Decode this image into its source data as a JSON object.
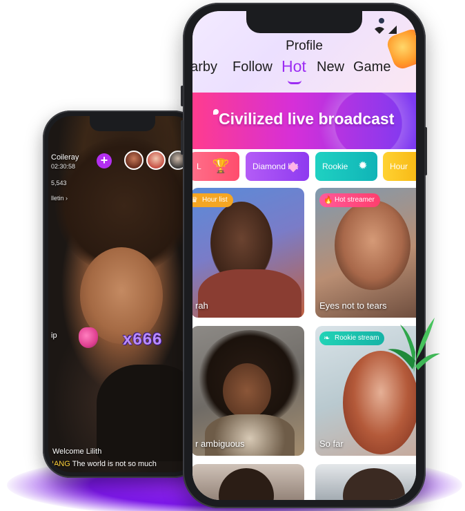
{
  "live_room": {
    "host_name": "Coileray",
    "host_id": "02:30:58",
    "follower_count": "5,543",
    "bulletin_label": "lletin",
    "add_button": "+",
    "side_label": "ip",
    "gift_combo": "x666",
    "welcome_message": "Welcome Lilith",
    "chat_user": "NANG",
    "chat_message": "The world is not so much"
  },
  "app": {
    "page_title": "Profile",
    "tabs": [
      {
        "label": "Nearby",
        "display": "earby"
      },
      {
        "label": "Follow",
        "display": "Follow"
      },
      {
        "label": "Hot",
        "display": "Hot",
        "active": true
      },
      {
        "label": "New",
        "display": "New"
      },
      {
        "label": "Game",
        "display": "Game"
      }
    ],
    "banner_text": "Civilized live broadcast",
    "chips": [
      {
        "label": "L",
        "color": "#ff5a75"
      },
      {
        "label": "Diamond list",
        "color": "#a84ff2"
      },
      {
        "label": "Rookie",
        "color": "#16c6be"
      },
      {
        "label": "Hour",
        "color": "#f8c21a"
      }
    ],
    "cards": [
      {
        "tag": "Hour list",
        "tag_color": "#f5a623",
        "name": "rah"
      },
      {
        "tag": "Hot streamer",
        "tag_color": "#ff5a75",
        "name": "Eyes not to tears"
      },
      {
        "tag": "",
        "tag_color": "",
        "name": "r ambiguous"
      },
      {
        "tag": "Rookie stream",
        "tag_color": "#19c3b4",
        "name": "So far"
      }
    ]
  },
  "colors": {
    "accent": "#9c2cf3",
    "floor_glow": "#7c18e8"
  }
}
